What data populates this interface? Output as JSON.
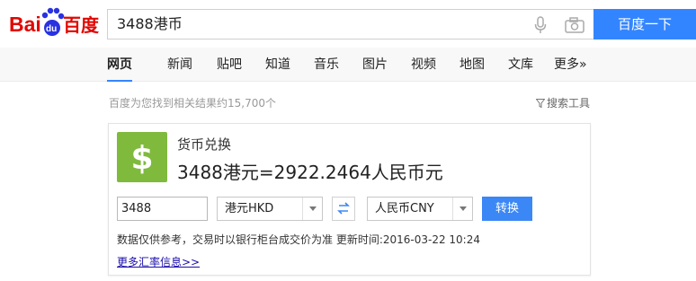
{
  "header": {
    "logo_text": "Bai百度",
    "query": "3488港币",
    "search_button": "百度一下"
  },
  "tabs": [
    {
      "label": "网页",
      "active": true
    },
    {
      "label": "新闻"
    },
    {
      "label": "贴吧"
    },
    {
      "label": "知道"
    },
    {
      "label": "音乐"
    },
    {
      "label": "图片"
    },
    {
      "label": "视频"
    },
    {
      "label": "地图"
    },
    {
      "label": "文库"
    },
    {
      "label": "更多»"
    }
  ],
  "results": {
    "count_text": "百度为您找到相关结果约15,700个",
    "tools_label": "搜索工具"
  },
  "converter": {
    "title": "货币兑换",
    "result": "3488港元=2922.2464人民币元",
    "amount": "3488",
    "from_currency": "港元HKD",
    "to_currency": "人民币CNY",
    "convert_button": "转换",
    "disclaimer": "数据仅供参考，交易时以银行柜台成交价为准 更新时间:2016-03-22 10:24",
    "more_link": "更多汇率信息>>"
  },
  "colors": {
    "accent": "#3385ff",
    "logo_red": "#e10601",
    "logo_blue": "#2932e1",
    "dollar_green": "#7fba3d"
  },
  "icons": [
    "baidu-paw-icon",
    "microphone-icon",
    "camera-icon",
    "funnel-icon",
    "dollar-icon",
    "swap-icon",
    "chevron-down-icon"
  ]
}
